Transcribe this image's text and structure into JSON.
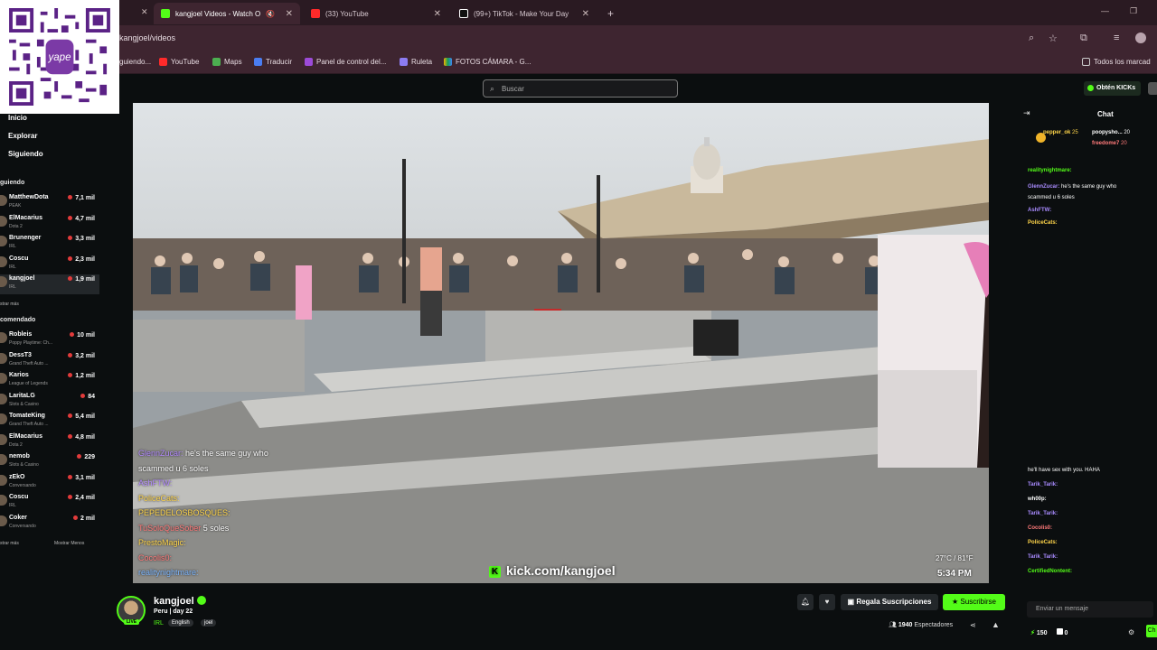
{
  "browser": {
    "tabs": [
      {
        "label": "kangjoel Videos - Watch O",
        "active": true
      },
      {
        "label": "(33) YouTube",
        "active": false
      },
      {
        "label": "(99+) TikTok - Make Your Day",
        "active": false
      }
    ],
    "new_tab": "+",
    "url": "kangjoel/videos",
    "bookmarks": [
      "guiendo...",
      "YouTube",
      "Maps",
      "Traducir",
      "Panel de control del...",
      "Ruleta",
      "FOTOS CÁMARA - G...",
      "Todos los marcad"
    ]
  },
  "colors": {
    "kick_green": "#53fc18",
    "chrome": "#3e2530"
  },
  "kick": {
    "search_placeholder": "Buscar",
    "get_kicks": "Obtén KICKs"
  },
  "sidebar": {
    "nav": [
      "Inicio",
      "Explorar",
      "Siguiendo"
    ],
    "following_header": "guiendo",
    "following": [
      {
        "name": "MatthewDota",
        "category": "PEAK",
        "viewers": "7,1 mil"
      },
      {
        "name": "ElMacarius",
        "category": "Dota 2",
        "viewers": "4,7 mil"
      },
      {
        "name": "Brunenger",
        "category": "IRL",
        "viewers": "3,3 mil"
      },
      {
        "name": "Coscu",
        "category": "IRL",
        "viewers": "2,3 mil"
      },
      {
        "name": "kangjoel",
        "category": "IRL",
        "viewers": "1,9 mil"
      }
    ],
    "show_more_1": "strar más",
    "recommended_header": "comendado",
    "recommended": [
      {
        "name": "Robleis",
        "category": "Poppy Playtime: Ch...",
        "viewers": "10 mil"
      },
      {
        "name": "DessT3",
        "category": "Grand Theft Auto ...",
        "viewers": "3,2 mil"
      },
      {
        "name": "Karios",
        "category": "League of Legends",
        "viewers": "1,2 mil"
      },
      {
        "name": "LaritaLG",
        "category": "Slots & Casino",
        "viewers": "84"
      },
      {
        "name": "TomateKing",
        "category": "Grand Theft Auto ...",
        "viewers": "5,4 mil"
      },
      {
        "name": "ElMacarius",
        "category": "Dota 2",
        "viewers": "4,8 mil"
      },
      {
        "name": "nemob",
        "category": "Slots & Casino",
        "viewers": "229"
      },
      {
        "name": "zEkO",
        "category": "Conversando",
        "viewers": "3,1 mil"
      },
      {
        "name": "Coscu",
        "category": "IRL",
        "viewers": "2,4 mil"
      },
      {
        "name": "Coker",
        "category": "Conversando",
        "viewers": "2 mil"
      }
    ],
    "show_more_2": "strar más",
    "show_less": "Mostrar Menos"
  },
  "video": {
    "overlay_chat": [
      {
        "user": "GlennZucar:",
        "text": "he's the same guy who"
      },
      {
        "user": "",
        "text": "scammed u 6 soles"
      },
      {
        "user": "AshFTW:",
        "text": ""
      },
      {
        "user": "PoliceCats:",
        "text": ""
      },
      {
        "user": "PEPEDELOSBOSQUES:",
        "text": ""
      },
      {
        "user": "TuSoloQueSober",
        "text": "5 soles"
      },
      {
        "user": "PrestoMagic:",
        "text": ""
      },
      {
        "user": "Cocolis0:",
        "text": ""
      },
      {
        "user": "realitynightmare:",
        "text": ""
      }
    ],
    "watermark": "kick.com/kangjoel",
    "weather": "27°C / 81°F",
    "time": "5:34 PM"
  },
  "streamer": {
    "name": "kangjoel",
    "live": "LIVE",
    "title": "Peru | day 22",
    "category": "IRL",
    "tags": [
      "English",
      "joel"
    ],
    "gift_button": "Regala Suscripciones",
    "subscribe_button": "Suscribirse",
    "viewers_count": "1940",
    "viewers_label": "Espectadores"
  },
  "chat": {
    "header": "Chat",
    "top_gifters": [
      {
        "name": "pepper_ok",
        "amount": "25"
      },
      {
        "name": "poopysho...",
        "amount": "20"
      },
      {
        "name": "freedome7",
        "amount": "20"
      }
    ],
    "messages": [
      {
        "user": "realitynightmare:",
        "text": "",
        "color": "#53fc18"
      },
      {
        "user": "GlennZucar:",
        "text": "he's the same guy who",
        "color": "#a98bff"
      },
      {
        "user": "",
        "text": "scammed u 6 soles",
        "color": "#fff"
      },
      {
        "user": "AshFTW:",
        "text": "",
        "color": "#a98bff"
      },
      {
        "user": "PoliceCats:",
        "text": "",
        "color": "#ffd54a"
      },
      {
        "user": "",
        "text": "he'll have sex with you. HAHA",
        "color": "#fff"
      },
      {
        "user": "Tarik_Tarik:",
        "text": "",
        "color": "#a98bff"
      },
      {
        "user": "wh00p:",
        "text": "",
        "color": "#fff"
      },
      {
        "user": "Tarik_Tarik:",
        "text": "",
        "color": "#a98bff"
      },
      {
        "user": "Cocolis0:",
        "text": "",
        "color": "#ff7a7a"
      },
      {
        "user": "PoliceCats:",
        "text": "",
        "color": "#ffd54a"
      },
      {
        "user": "Tarik_Tarik:",
        "text": "",
        "color": "#a98bff"
      },
      {
        "user": "CertifiedNontent:",
        "text": "",
        "color": "#53fc18"
      }
    ],
    "input_placeholder": "Enviar un mensaje",
    "points": "150",
    "coins": "0",
    "send": "Ch"
  }
}
